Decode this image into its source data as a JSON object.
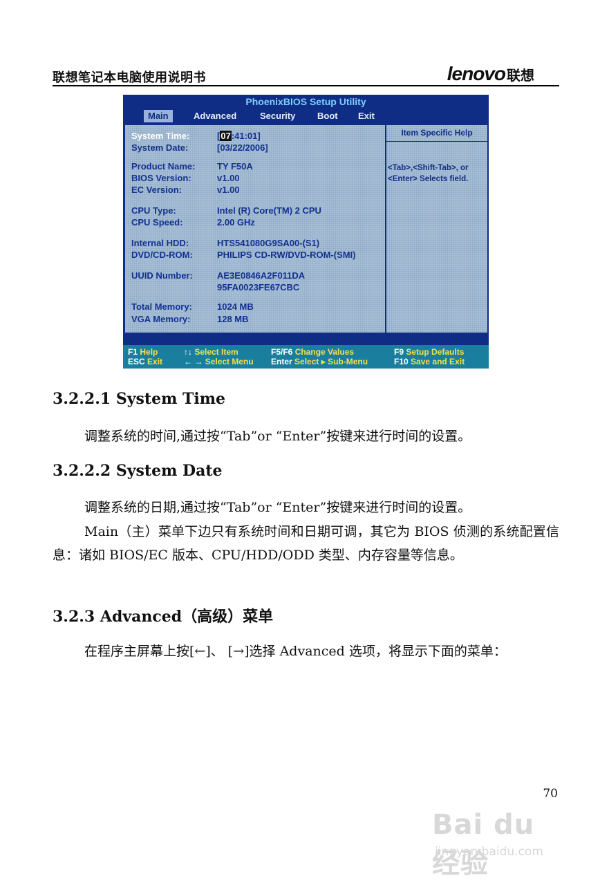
{
  "header": {
    "title": "联想笔记本电脑使用说明书",
    "logo_text": "lenovo",
    "logo_cn": "联想"
  },
  "bios": {
    "title": "PhoenixBIOS Setup Utility",
    "tabs": [
      "Main",
      "Advanced",
      "Security",
      "Boot",
      "Exit"
    ],
    "fields": {
      "system_time_label": "System Time:",
      "system_time_cursor": "07",
      "system_time_rest": ":41:01]",
      "system_time_open": "[",
      "system_date_label": "System Date:",
      "system_date_value": "[03/22/2006]",
      "product_name_label": "Product Name:",
      "product_name_value": "TY  F50A",
      "bios_version_label": "BIOS Version:",
      "bios_version_value": "v1.00",
      "ec_version_label": "EC    Version:",
      "ec_version_value": "v1.00",
      "cpu_type_label": "CPU Type:",
      "cpu_type_value": "Intel (R) Core(TM) 2 CPU",
      "cpu_speed_label": "CPU Speed:",
      "cpu_speed_value": "2.00 GHz",
      "internal_hdd_label": "Internal HDD:",
      "internal_hdd_value": "HTS541080G9SA00-(S1)",
      "dvd_label": "DVD/CD-ROM:",
      "dvd_value": "PHILIPS CD-RW/DVD-ROM-(SMI)",
      "uuid_label": "UUID Number:",
      "uuid_value_1": "AE3E0846A2F011DA",
      "uuid_value_2": "95FA0023FE67CBC",
      "total_memory_label": "Total Memory:",
      "total_memory_value": "1024 MB",
      "vga_memory_label": "VGA  Memory:",
      "vga_memory_value": "128 MB"
    },
    "help": {
      "heading": "Item Specific Help",
      "text": "<Tab>,<Shift-Tab>, or <Enter> Selects field."
    },
    "footer": {
      "f1_key": "F1",
      "f1_desc": "Help",
      "esc_key": "ESC",
      "esc_desc": "Exit",
      "updown_key": "↑↓",
      "updown_desc": "Select Item",
      "leftright_key": "← →",
      "leftright_desc": "Select Menu",
      "f5f6_key": "F5/F6",
      "f5f6_desc": "Change Values",
      "enter_key": "Enter",
      "enter_desc": "Select ▸ Sub-Menu",
      "f9_key": "F9",
      "f9_desc": "Setup Defaults",
      "f10_key": "F10",
      "f10_desc": "Save and Exit"
    }
  },
  "sections": {
    "s1_heading": "3.2.2.1 System Time",
    "s1_para": "调整系统的时间,通过按“Tab”or “Enter”按键来进行时间的设置。",
    "s2_heading": "3.2.2.2 System Date",
    "s2_para1": "调整系统的日期,通过按“Tab”or “Enter”按键来进行时间的设置。",
    "s2_para2": "Main（主）菜单下边只有系统时间和日期可调，其它为 BIOS 侦测的系统配置信息：诸如 BIOS/EC  版本、CPU/HDD/ODD 类型、内存容量等信息。",
    "s3_heading": "3.2.3    Advanced（高级）菜单",
    "s3_para": "在程序主屏幕上按[←]、 [→]选择 Advanced 选项，将显示下面的菜单："
  },
  "page_number": "70",
  "watermark": {
    "brand": "Bai du 经验",
    "url": "jingyan.baidu.com"
  }
}
